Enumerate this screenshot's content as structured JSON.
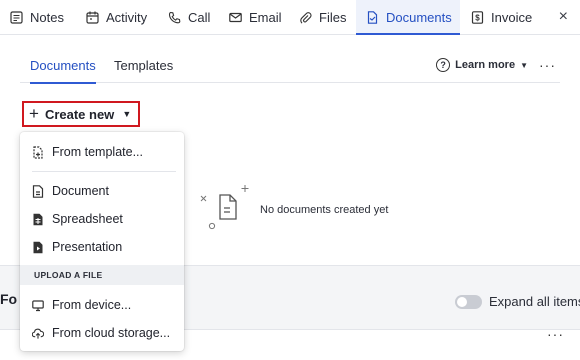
{
  "top_tabs": [
    {
      "label": "Notes",
      "icon": "note-icon"
    },
    {
      "label": "Activity",
      "icon": "calendar-icon"
    },
    {
      "label": "Call",
      "icon": "phone-icon"
    },
    {
      "label": "Email",
      "icon": "mail-icon"
    },
    {
      "label": "Files",
      "icon": "paperclip-icon"
    },
    {
      "label": "Documents",
      "icon": "document-icon",
      "active": true
    },
    {
      "label": "Invoice",
      "icon": "invoice-icon"
    }
  ],
  "close_label": "×",
  "subtabs": [
    {
      "label": "Documents",
      "active": true
    },
    {
      "label": "Templates"
    }
  ],
  "learn_more": {
    "label": "Learn more"
  },
  "create_button": {
    "label": "Create new"
  },
  "empty_state": {
    "text": "No documents created yet"
  },
  "menu": {
    "items": [
      {
        "label": "From template...",
        "icon": "template-icon"
      },
      {
        "label": "Document",
        "icon": "document-icon"
      },
      {
        "label": "Spreadsheet",
        "icon": "spreadsheet-icon"
      },
      {
        "label": "Presentation",
        "icon": "presentation-icon"
      }
    ],
    "upload_header": "UPLOAD A FILE",
    "upload_items": [
      {
        "label": "From device...",
        "icon": "monitor-icon"
      },
      {
        "label": "From cloud storage...",
        "icon": "cloud-upload-icon"
      }
    ]
  },
  "lower": {
    "focus_title": "Fo",
    "expand_label": "Expand all items"
  },
  "colors": {
    "accent": "#2f5ad3",
    "highlight_border": "#d0181f"
  }
}
